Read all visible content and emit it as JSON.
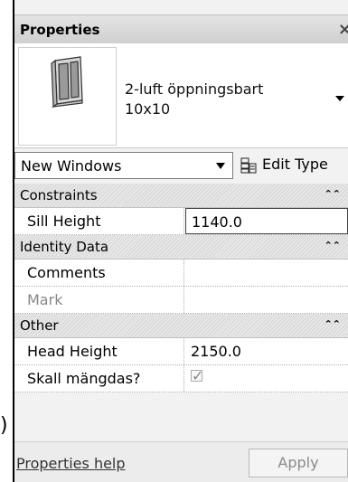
{
  "panel": {
    "title": "Properties",
    "close_glyph": "×"
  },
  "type_selector": {
    "name_line1": "2-luft öppningsbart",
    "name_line2": "10x10",
    "preview_icon": "window-preview-icon"
  },
  "instance_filter": {
    "selected": "New Windows",
    "edit_type_label": "Edit Type"
  },
  "sections": {
    "constraints": {
      "label": "Constraints",
      "collapse_glyph": "⌃⌃"
    },
    "identity": {
      "label": "Identity Data",
      "collapse_glyph": "⌃⌃"
    },
    "other": {
      "label": "Other",
      "collapse_glyph": "⌃⌃"
    }
  },
  "properties": {
    "sill_height": {
      "name": "Sill Height",
      "value": "1140.0"
    },
    "comments": {
      "name": "Comments",
      "value": ""
    },
    "mark": {
      "name": "Mark",
      "value": ""
    },
    "head_height": {
      "name": "Head Height",
      "value": "2150.0"
    },
    "skall_mangdas": {
      "name": "Skall mängdas?",
      "checked_glyph": "✓"
    }
  },
  "footer": {
    "help_link": "Properties help",
    "apply_label": "Apply"
  },
  "stray": {
    "paren": ")"
  }
}
